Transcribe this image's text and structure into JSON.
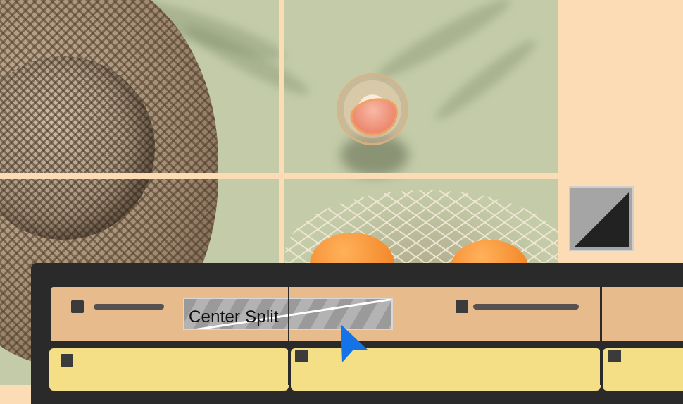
{
  "canvas": {
    "photo_description_icons": [
      "straw-hat",
      "glass-with-grapefruit",
      "mesh-bag-oranges"
    ]
  },
  "transition_preview": {
    "icon": "diagonal-split-icon"
  },
  "timeline": {
    "transition_label": "Center Split",
    "colors": {
      "panel": "#2a2a2a",
      "video_track": "#e8bb8c",
      "audio_track": "#f4de86",
      "cursor": "#1473e6",
      "transition_chip": "#a5a5a5"
    }
  }
}
